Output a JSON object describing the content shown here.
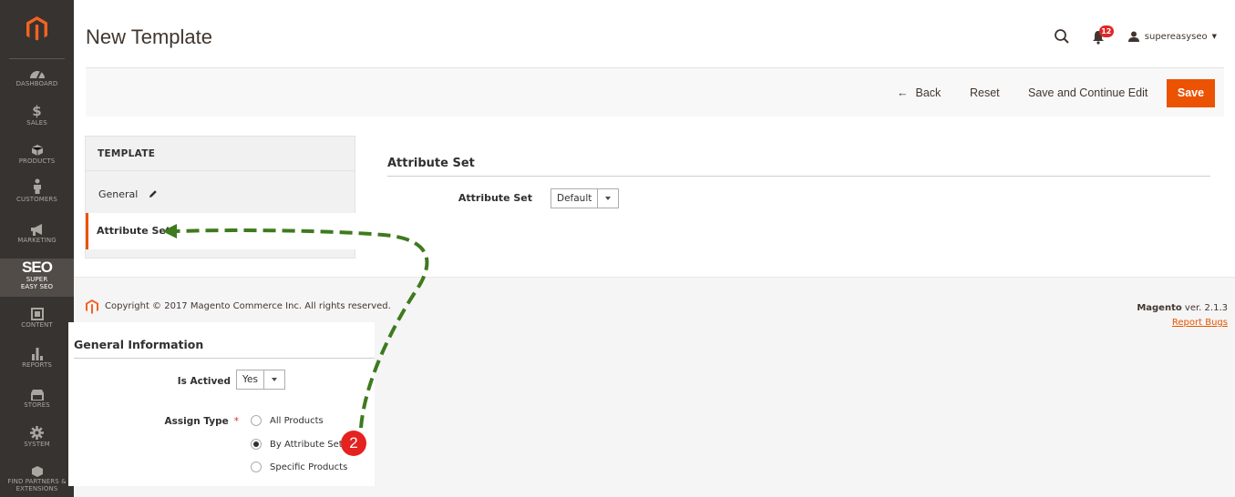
{
  "nav": {
    "items": [
      {
        "label": "DASHBOARD",
        "icon": "dashboard-icon"
      },
      {
        "label": "SALES",
        "icon": "dollar-icon"
      },
      {
        "label": "PRODUCTS",
        "icon": "cube-icon"
      },
      {
        "label": "CUSTOMERS",
        "icon": "person-icon"
      },
      {
        "label": "MARKETING",
        "icon": "megaphone-icon"
      },
      {
        "label": "SUPER EASY SEO",
        "icon": "seo-icon",
        "logo_text": "SEO"
      },
      {
        "label": "CONTENT",
        "icon": "layout-icon"
      },
      {
        "label": "REPORTS",
        "icon": "bar-chart-icon"
      },
      {
        "label": "STORES",
        "icon": "store-icon"
      },
      {
        "label": "SYSTEM",
        "icon": "gear-icon"
      },
      {
        "label": "FIND PARTNERS & EXTENSIONS",
        "icon": "box-icon"
      }
    ]
  },
  "header": {
    "title": "New Template",
    "notification_count": "12",
    "username": "supereasyseo"
  },
  "actions": {
    "back": "Back",
    "reset": "Reset",
    "save_continue": "Save and Continue Edit",
    "save": "Save"
  },
  "tabs": {
    "title": "TEMPLATE",
    "items": [
      "General",
      "Attribute Set"
    ],
    "active": "Attribute Set"
  },
  "main": {
    "section_title": "Attribute Set",
    "attribute_set_label": "Attribute Set",
    "attribute_set_value": "Default"
  },
  "footer": {
    "copyright": "Copyright © 2017 Magento Commerce Inc. All rights reserved.",
    "brand": "Magento",
    "version": "ver. 2.1.3",
    "report_bugs": "Report Bugs"
  },
  "inset": {
    "title": "General Information",
    "is_actived_label": "Is Actived",
    "is_actived_value": "Yes",
    "assign_type_label": "Assign Type",
    "required_mark": "*",
    "options": [
      "All Products",
      "By Attribute Set",
      "Specific Products"
    ],
    "selected": "By Attribute Set",
    "step_number": "2"
  },
  "colors": {
    "nav_bg": "#373330",
    "accent": "#eb5202",
    "arrow": "#3e7a1e",
    "step_badge": "#e42220"
  }
}
